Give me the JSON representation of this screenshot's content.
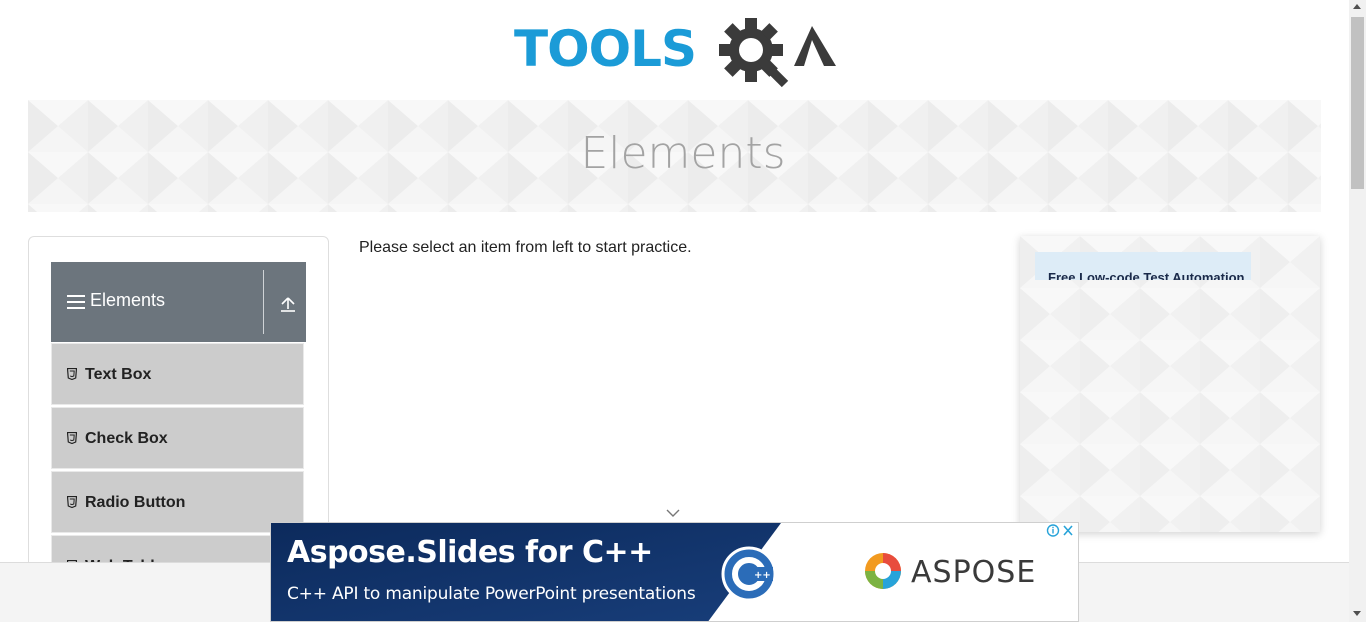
{
  "logo": {
    "text_tools": "TOOLS",
    "text_qa": "QA",
    "colors": {
      "tools": "#1b9bd7",
      "qa": "#3b3b3b"
    }
  },
  "banner": {
    "title": "Elements"
  },
  "sidebar": {
    "group_title": "Elements",
    "items": [
      {
        "label": "Text Box",
        "icon": "html5-icon"
      },
      {
        "label": "Check Box",
        "icon": "html5-icon"
      },
      {
        "label": "Radio Button",
        "icon": "html5-icon"
      },
      {
        "label": "Web Tables",
        "icon": "html5-icon"
      }
    ]
  },
  "main": {
    "instruction": "Please select an item from left to start practice."
  },
  "right_ad": {
    "headline": "Free Low-code Test Automation"
  },
  "bottom_ad": {
    "headline": "Aspose.Slides for C++",
    "subline": "C++ API to manipulate PowerPoint presentations",
    "brand": "ASPOSE",
    "colors": {
      "dark": "#0c2a5c",
      "brand_text": "#3a3a3a"
    }
  },
  "colors": {
    "accent_blue": "#1b9bd7",
    "group_header": "#6c757d",
    "menu_item": "#cccccc"
  }
}
